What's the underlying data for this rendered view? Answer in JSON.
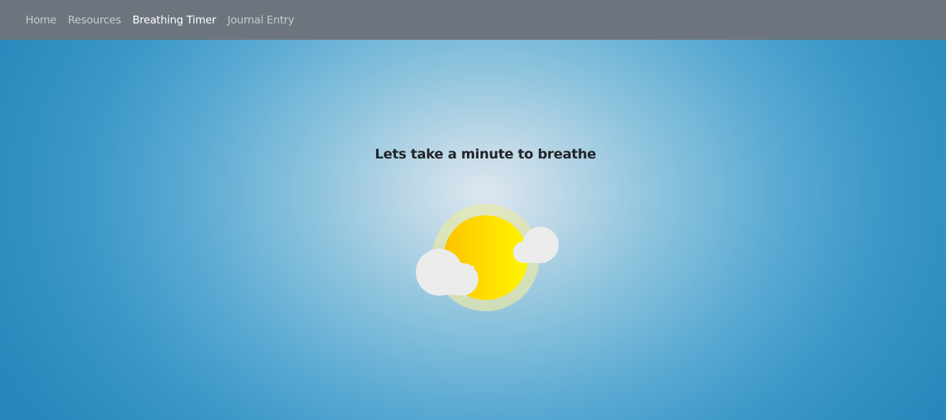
{
  "nav": {
    "items": [
      {
        "label": "Home"
      },
      {
        "label": "Resources"
      },
      {
        "label": "Breathing Timer",
        "active": true
      },
      {
        "label": "Journal Entry"
      }
    ]
  },
  "main": {
    "heading": "Lets take a minute to breathe"
  },
  "colors": {
    "navbar_bg": "#6c757d",
    "sky_center": "#dde7ef",
    "sky_edge": "#2888bb",
    "sun_left": "#ffc200",
    "sun_right": "#fff600",
    "sun_glow": "#e6e8aa",
    "cloud": "#ebebeb"
  },
  "icons": [
    "sun-icon",
    "cloud-icon"
  ]
}
